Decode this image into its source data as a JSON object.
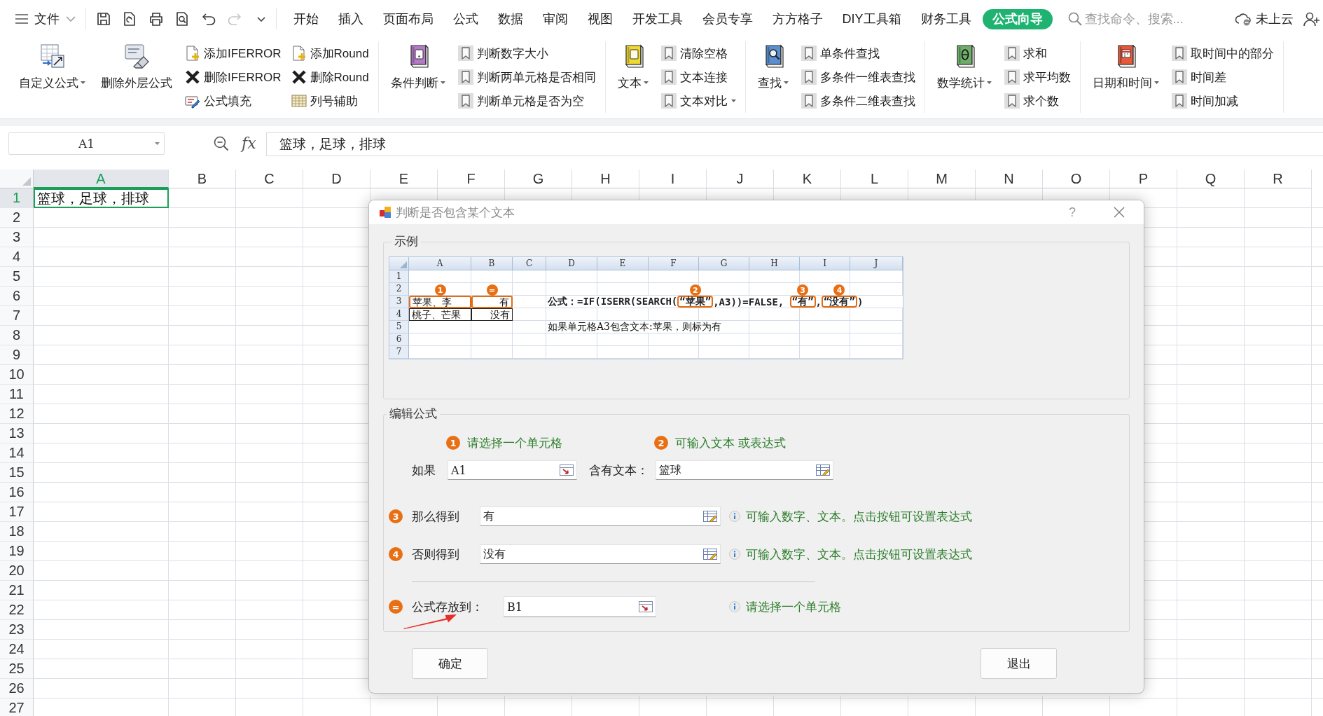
{
  "menu_bar": {
    "file_menu": "文件",
    "quick_tools": [
      {
        "kind": "save",
        "disabled": false
      },
      {
        "kind": "export",
        "disabled": false
      },
      {
        "kind": "print",
        "disabled": false
      },
      {
        "kind": "preview",
        "disabled": false
      },
      {
        "kind": "undo",
        "disabled": false
      },
      {
        "kind": "redo",
        "disabled": true
      },
      {
        "kind": "more",
        "disabled": false
      }
    ],
    "tabs": [
      {
        "label": "开始",
        "selected": false
      },
      {
        "label": "插入",
        "selected": false
      },
      {
        "label": "页面布局",
        "selected": false
      },
      {
        "label": "公式",
        "selected": false
      },
      {
        "label": "数据",
        "selected": false
      },
      {
        "label": "审阅",
        "selected": false
      },
      {
        "label": "视图",
        "selected": false
      },
      {
        "label": "开发工具",
        "selected": false
      },
      {
        "label": "会员专享",
        "selected": false
      },
      {
        "label": "方方格子",
        "selected": false
      },
      {
        "label": "DIY工具箱",
        "selected": false
      },
      {
        "label": "财务工具",
        "selected": false
      },
      {
        "label": "公式向导",
        "selected": true
      }
    ],
    "search": {
      "placeholder": "查找命令、搜索..."
    },
    "cloud_status": "未上云"
  },
  "ribbon": {
    "groups": [
      {
        "large": [
          {
            "label": "自定义公式",
            "kind": "custom",
            "dropdown": true
          },
          {
            "label": "删除外层公式",
            "kind": "eraser",
            "dropdown": false
          }
        ],
        "columns": [
          [
            {
              "label": "添加IFERROR",
              "kind": "add",
              "dropdown": false
            },
            {
              "label": "删除IFERROR",
              "kind": "remove",
              "dropdown": false
            },
            {
              "label": "公式填充",
              "kind": "fill",
              "dropdown": false
            }
          ],
          [
            {
              "label": "添加Round",
              "kind": "add",
              "dropdown": false
            },
            {
              "label": "删除Round",
              "kind": "remove",
              "dropdown": false
            },
            {
              "label": "列号辅助",
              "kind": "grid",
              "dropdown": false
            }
          ]
        ]
      },
      {
        "large": [
          {
            "label": "条件判断",
            "kind": "condition",
            "dropdown": true
          }
        ],
        "columns": [
          [
            {
              "label": "判断数字大小",
              "kind": "bookmark",
              "dropdown": false
            },
            {
              "label": "判断两单元格是否相同",
              "kind": "bookmark",
              "dropdown": false
            },
            {
              "label": "判断单元格是否为空",
              "kind": "bookmark",
              "dropdown": false
            }
          ]
        ]
      },
      {
        "large": [
          {
            "label": "文本",
            "kind": "text",
            "dropdown": true
          }
        ],
        "columns": [
          [
            {
              "label": "清除空格",
              "kind": "bookmark",
              "dropdown": false
            },
            {
              "label": "文本连接",
              "kind": "bookmark",
              "dropdown": false
            },
            {
              "label": "文本对比",
              "kind": "bookmark",
              "dropdown": true
            }
          ]
        ]
      },
      {
        "large": [
          {
            "label": "查找",
            "kind": "lookup",
            "dropdown": true
          }
        ],
        "columns": [
          [
            {
              "label": "单条件查找",
              "kind": "bookmark",
              "dropdown": false
            },
            {
              "label": "多条件一维表查找",
              "kind": "bookmark",
              "dropdown": false
            },
            {
              "label": "多条件二维表查找",
              "kind": "bookmark",
              "dropdown": false
            }
          ]
        ]
      },
      {
        "large": [
          {
            "label": "数学统计",
            "kind": "math",
            "dropdown": true
          }
        ],
        "columns": [
          [
            {
              "label": "求和",
              "kind": "bookmark",
              "dropdown": false
            },
            {
              "label": "求平均数",
              "kind": "bookmark",
              "dropdown": false
            },
            {
              "label": "求个数",
              "kind": "bookmark",
              "dropdown": false
            }
          ]
        ]
      },
      {
        "large": [
          {
            "label": "日期和时间",
            "kind": "date",
            "dropdown": true
          }
        ],
        "columns": [
          [
            {
              "label": "取时间中的部分",
              "kind": "bookmark",
              "dropdown": false
            },
            {
              "label": "时间差",
              "kind": "bookmark",
              "dropdown": false
            },
            {
              "label": "时间加减",
              "kind": "bookmark",
              "dropdown": false
            }
          ]
        ]
      }
    ]
  },
  "formula_bar": {
    "name_box": "A1",
    "function_label": "fx",
    "formula": "篮球，足球，排球"
  },
  "sheet": {
    "columns": [
      {
        "label": "A",
        "selected": true
      },
      {
        "label": "B",
        "selected": false
      },
      {
        "label": "C",
        "selected": false
      },
      {
        "label": "D",
        "selected": false
      },
      {
        "label": "E",
        "selected": false
      },
      {
        "label": "F",
        "selected": false
      },
      {
        "label": "G",
        "selected": false
      },
      {
        "label": "H",
        "selected": false
      },
      {
        "label": "I",
        "selected": false
      },
      {
        "label": "J",
        "selected": false
      },
      {
        "label": "K",
        "selected": false
      },
      {
        "label": "L",
        "selected": false
      },
      {
        "label": "M",
        "selected": false
      },
      {
        "label": "N",
        "selected": false
      },
      {
        "label": "O",
        "selected": false
      },
      {
        "label": "P",
        "selected": false
      },
      {
        "label": "Q",
        "selected": false
      },
      {
        "label": "R",
        "selected": false
      }
    ],
    "rows": [
      {
        "label": "1",
        "selected": true,
        "cells": [
          {
            "text": "篮球，足球，排球",
            "selected": true
          }
        ]
      },
      {
        "label": "2",
        "selected": false
      },
      {
        "label": "3",
        "selected": false
      },
      {
        "label": "4",
        "selected": false
      },
      {
        "label": "5",
        "selected": false
      },
      {
        "label": "6",
        "selected": false
      },
      {
        "label": "7",
        "selected": false
      },
      {
        "label": "8",
        "selected": false
      },
      {
        "label": "9",
        "selected": false
      },
      {
        "label": "10",
        "selected": false
      },
      {
        "label": "11",
        "selected": false
      },
      {
        "label": "12",
        "selected": false
      },
      {
        "label": "13",
        "selected": false
      },
      {
        "label": "14",
        "selected": false
      },
      {
        "label": "15",
        "selected": false
      },
      {
        "label": "16",
        "selected": false
      },
      {
        "label": "17",
        "selected": false
      },
      {
        "label": "18",
        "selected": false
      },
      {
        "label": "19",
        "selected": false
      },
      {
        "label": "20",
        "selected": false
      },
      {
        "label": "21",
        "selected": false
      },
      {
        "label": "22",
        "selected": false
      },
      {
        "label": "23",
        "selected": false
      },
      {
        "label": "24",
        "selected": false
      },
      {
        "label": "25",
        "selected": false
      },
      {
        "label": "26",
        "selected": false
      },
      {
        "label": "27",
        "selected": false
      }
    ]
  },
  "dialog": {
    "title": "判断是否包含某个文本",
    "help": "?",
    "example": {
      "title": "示例",
      "columns": [
        "A",
        "B",
        "C",
        "D",
        "E",
        "F",
        "G",
        "H",
        "I",
        "J"
      ],
      "rows": [
        "1",
        "2",
        "3",
        "4",
        "5",
        "6",
        "7"
      ],
      "samples": [
        {
          "text": "苹果、李",
          "result": "有",
          "highlight": true,
          "text_marker": "1",
          "result_marker": "="
        },
        {
          "text": "桃子、芒果",
          "result": "没有",
          "highlight": false
        }
      ],
      "formula": [
        {
          "text": "公式：=IF(ISERR(SEARCH(",
          "highlight": false
        },
        {
          "text": "“苹果”",
          "highlight": true,
          "marker": "2"
        },
        {
          "text": ",A3))=FALSE, ",
          "highlight": false
        },
        {
          "text": "“有”",
          "highlight": true,
          "marker": "3"
        },
        {
          "text": ",",
          "highlight": false
        },
        {
          "text": "“没有”",
          "highlight": true,
          "marker": "4"
        },
        {
          "text": ")",
          "highlight": false
        }
      ],
      "note": "如果单元格A3包含文本:苹果，则标为有"
    },
    "editor": {
      "title": "编辑公式",
      "hints": [
        {
          "marker": "1",
          "text": "请选择一个单元格"
        },
        {
          "marker": "2",
          "text": "可输入文本 或表达式"
        }
      ],
      "fields": [
        {
          "label": "如果",
          "value": "A1",
          "kind": "cell"
        },
        {
          "label": "含有文本：",
          "value": "篮球",
          "kind": "expression"
        }
      ],
      "results": [
        {
          "marker": "3",
          "label": "那么得到",
          "value": "有",
          "kind": "expression",
          "hint": "可输入数字、文本。点击按钮可设置表达式"
        },
        {
          "marker": "4",
          "label": "否则得到",
          "value": "没有",
          "kind": "expression",
          "hint": "可输入数字、文本。点击按钮可设置表达式"
        }
      ],
      "output": {
        "marker": "=",
        "label": "公式存放到：",
        "value": "B1",
        "kind": "cell",
        "hint": "请选择一个单元格"
      }
    },
    "buttons": [
      "确定",
      "退出"
    ]
  }
}
